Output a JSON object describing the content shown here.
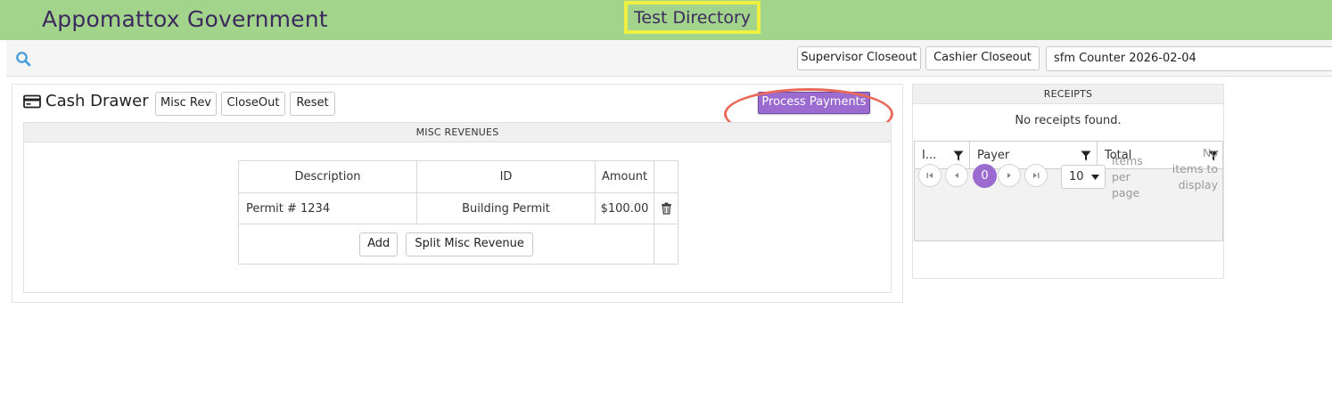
{
  "header": {
    "app_title": "Appomattox Government",
    "directory_title": "Test Directory"
  },
  "toolbar": {
    "supervisor_closeout_label": "Supervisor Closeout",
    "cashier_closeout_label": "Cashier Closeout",
    "counter_value": "sfm Counter 2026-02-04"
  },
  "cash_drawer": {
    "title": "Cash Drawer",
    "misc_rev_label": "Misc Rev",
    "closeout_label": "CloseOut",
    "reset_label": "Reset",
    "process_payments_label": "Process Payments",
    "misc_revenues": {
      "section_title": "MISC REVENUES",
      "columns": [
        "Description",
        "ID",
        "Amount"
      ],
      "rows": [
        {
          "description": "Permit # 1234",
          "id": "Building Permit",
          "amount": "$100.00"
        }
      ],
      "add_label": "Add",
      "split_label": "Split Misc Revenue"
    }
  },
  "receipts": {
    "section_title": "RECEIPTS",
    "empty_message": "No receipts found.",
    "columns": [
      "I...",
      "Payer",
      "Total"
    ],
    "pager": {
      "current_page": "0",
      "page_size": "10",
      "items_per_page_label": "items per page",
      "no_items_label": "No items to display"
    }
  },
  "colors": {
    "header_bg": "#a3d48b",
    "accent_purple": "#9b6bcf",
    "title_purple": "#3c2a5e",
    "highlight_yellow": "#f0f040",
    "highlight_red": "#ea6a5a"
  }
}
